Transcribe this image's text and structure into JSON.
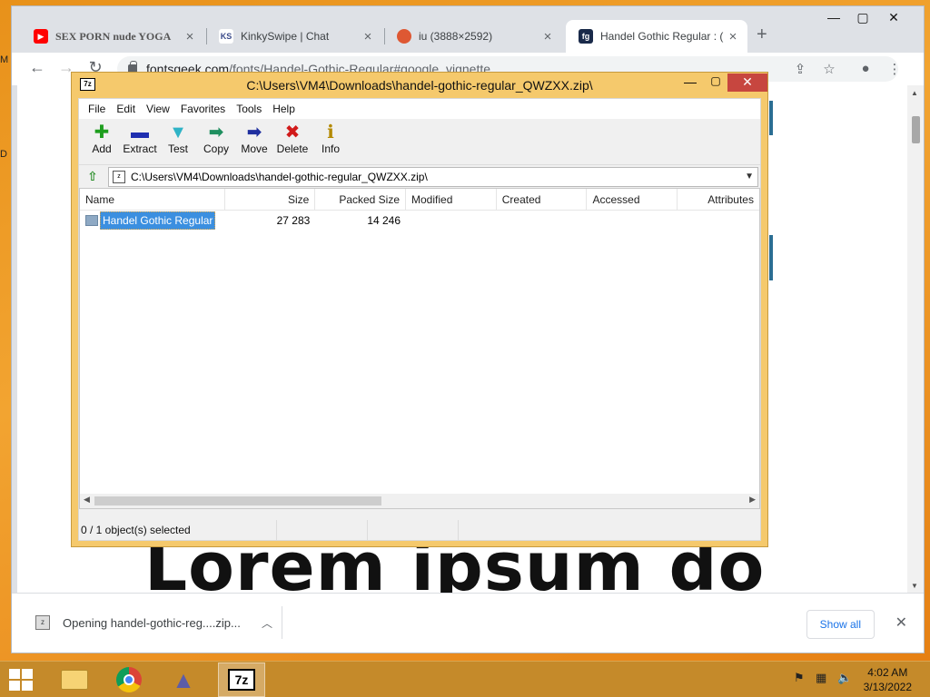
{
  "browser": {
    "tabs": [
      {
        "title": "SEX PORN nude YOGA",
        "favicon": "youtube-icon",
        "fav_color": "#ff0000"
      },
      {
        "title": "KinkySwipe | Chat",
        "favicon": "ks-icon",
        "fav_text": "KS"
      },
      {
        "title": "iu (3888×2592)",
        "favicon": "duckduckgo-icon",
        "fav_color": "#de5833"
      },
      {
        "title": "Handel Gothic Regular : (",
        "favicon": "fontsgeek-icon",
        "fav_text": "fg",
        "active": true
      }
    ],
    "url_domain": "fontsgeek.com",
    "url_path": "/fonts/Handel-Gothic-Regular#google_vignette",
    "page_text": "Lorem ipsum do"
  },
  "downloads": {
    "item_label": "Opening handel-gothic-reg....zip...",
    "show_all_label": "Show all"
  },
  "zip": {
    "window_title": "C:\\Users\\VM4\\Downloads\\handel-gothic-regular_QWZXX.zip\\",
    "menu": [
      "File",
      "Edit",
      "View",
      "Favorites",
      "Tools",
      "Help"
    ],
    "toolbar": [
      {
        "label": "Add",
        "icon": "add-icon",
        "glyph": "✚",
        "color": "#1e9e1e"
      },
      {
        "label": "Extract",
        "icon": "extract-icon",
        "glyph": "▬",
        "color": "#1f2fb0"
      },
      {
        "label": "Test",
        "icon": "test-icon",
        "glyph": "▼",
        "color": "#2fb3c6"
      },
      {
        "label": "Copy",
        "icon": "copy-icon",
        "glyph": "➡",
        "color": "#1f8f5f"
      },
      {
        "label": "Move",
        "icon": "move-icon",
        "glyph": "➡",
        "color": "#1f2f9f"
      },
      {
        "label": "Delete",
        "icon": "delete-icon",
        "glyph": "✖",
        "color": "#d11a1a"
      },
      {
        "label": "Info",
        "icon": "info-icon",
        "glyph": "ℹ",
        "color": "#b38900"
      }
    ],
    "address": "C:\\Users\\VM4\\Downloads\\handel-gothic-regular_QWZXX.zip\\",
    "columns": [
      "Name",
      "Size",
      "Packed Size",
      "Modified",
      "Created",
      "Accessed",
      "Attributes"
    ],
    "rows": [
      {
        "name": "Handel Gothic Regular",
        "size": "27 283",
        "packed": "14 246",
        "modified": "",
        "created": "",
        "accessed": "",
        "attributes": ""
      }
    ],
    "status": "0 / 1 object(s) selected"
  },
  "taskbar": {
    "time": "4:02 AM",
    "date": "3/13/2022"
  },
  "desktop": {
    "edge_labels": [
      "M",
      "D"
    ]
  }
}
